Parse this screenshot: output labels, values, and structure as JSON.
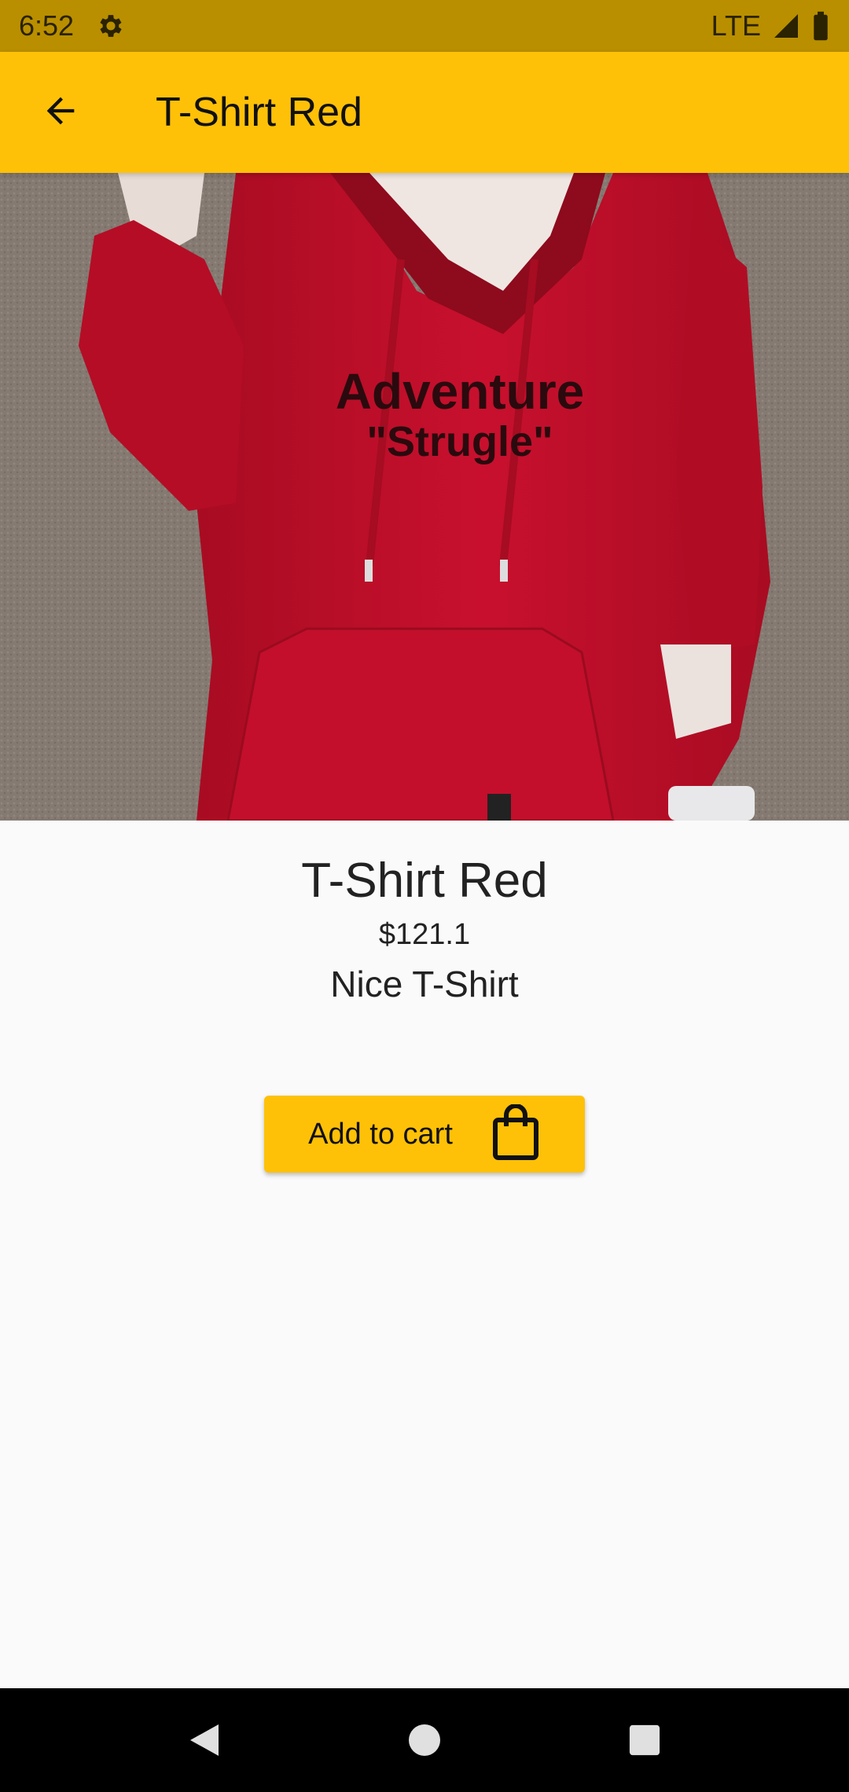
{
  "status_bar": {
    "time": "6:52",
    "network": "LTE",
    "icons": [
      "settings-icon",
      "signal-icon",
      "battery-icon"
    ]
  },
  "app_bar": {
    "title": "T-Shirt Red",
    "back_icon": "arrow-back-icon"
  },
  "product": {
    "name": "T-Shirt Red",
    "price": "$121.1",
    "description": "Nice T-Shirt",
    "image_print_text": [
      "Adventure",
      "\"Strugle\""
    ]
  },
  "cart_button": {
    "label": "Add to cart",
    "icon": "shopping-bag-icon"
  },
  "nav_bar": {
    "icons": [
      "nav-back-icon",
      "nav-home-icon",
      "nav-recents-icon"
    ]
  },
  "colors": {
    "accent": "#ffc107",
    "status_bar": "#b98f00",
    "background": "#fafafa",
    "hoodie": "#c8102e"
  }
}
